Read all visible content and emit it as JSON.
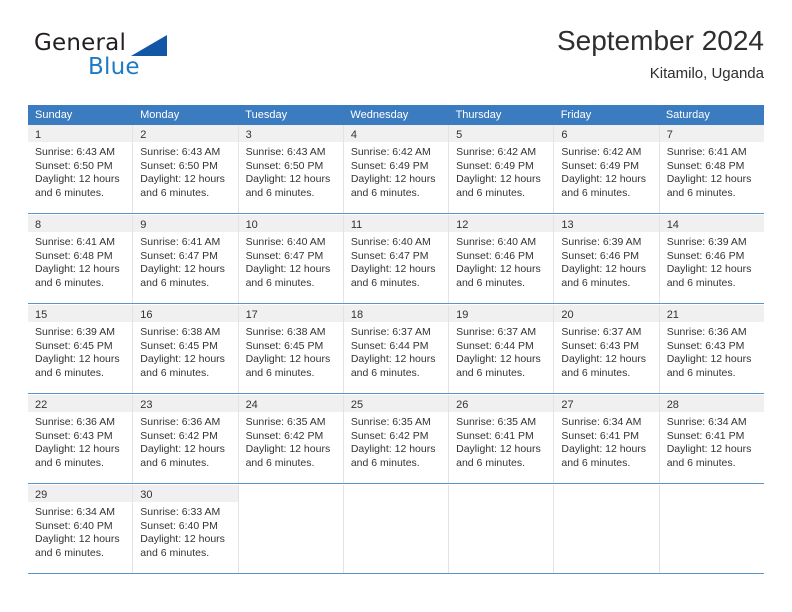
{
  "brand": {
    "name_part1": "General",
    "name_part2": "Blue",
    "logo_icon": "triangle-logo-icon"
  },
  "header": {
    "title": "September 2024",
    "subtitle": "Kitamilo, Uganda"
  },
  "calendar": {
    "weekday_headers": [
      "Sunday",
      "Monday",
      "Tuesday",
      "Wednesday",
      "Thursday",
      "Friday",
      "Saturday"
    ],
    "colors": {
      "header_blue": "#3b7cc0",
      "week_divider_blue": "#5b93cd",
      "day_band_gray": "#f0f0f0",
      "brand_blue": "#1f7ac4",
      "logo_triangle_blue": "#1257a5"
    },
    "weeks": [
      [
        {
          "day": "1",
          "sunrise": "Sunrise: 6:43 AM",
          "sunset": "Sunset: 6:50 PM",
          "daylight_line1": "Daylight: 12 hours",
          "daylight_line2": "and 6 minutes."
        },
        {
          "day": "2",
          "sunrise": "Sunrise: 6:43 AM",
          "sunset": "Sunset: 6:50 PM",
          "daylight_line1": "Daylight: 12 hours",
          "daylight_line2": "and 6 minutes."
        },
        {
          "day": "3",
          "sunrise": "Sunrise: 6:43 AM",
          "sunset": "Sunset: 6:50 PM",
          "daylight_line1": "Daylight: 12 hours",
          "daylight_line2": "and 6 minutes."
        },
        {
          "day": "4",
          "sunrise": "Sunrise: 6:42 AM",
          "sunset": "Sunset: 6:49 PM",
          "daylight_line1": "Daylight: 12 hours",
          "daylight_line2": "and 6 minutes."
        },
        {
          "day": "5",
          "sunrise": "Sunrise: 6:42 AM",
          "sunset": "Sunset: 6:49 PM",
          "daylight_line1": "Daylight: 12 hours",
          "daylight_line2": "and 6 minutes."
        },
        {
          "day": "6",
          "sunrise": "Sunrise: 6:42 AM",
          "sunset": "Sunset: 6:49 PM",
          "daylight_line1": "Daylight: 12 hours",
          "daylight_line2": "and 6 minutes."
        },
        {
          "day": "7",
          "sunrise": "Sunrise: 6:41 AM",
          "sunset": "Sunset: 6:48 PM",
          "daylight_line1": "Daylight: 12 hours",
          "daylight_line2": "and 6 minutes."
        }
      ],
      [
        {
          "day": "8",
          "sunrise": "Sunrise: 6:41 AM",
          "sunset": "Sunset: 6:48 PM",
          "daylight_line1": "Daylight: 12 hours",
          "daylight_line2": "and 6 minutes."
        },
        {
          "day": "9",
          "sunrise": "Sunrise: 6:41 AM",
          "sunset": "Sunset: 6:47 PM",
          "daylight_line1": "Daylight: 12 hours",
          "daylight_line2": "and 6 minutes."
        },
        {
          "day": "10",
          "sunrise": "Sunrise: 6:40 AM",
          "sunset": "Sunset: 6:47 PM",
          "daylight_line1": "Daylight: 12 hours",
          "daylight_line2": "and 6 minutes."
        },
        {
          "day": "11",
          "sunrise": "Sunrise: 6:40 AM",
          "sunset": "Sunset: 6:47 PM",
          "daylight_line1": "Daylight: 12 hours",
          "daylight_line2": "and 6 minutes."
        },
        {
          "day": "12",
          "sunrise": "Sunrise: 6:40 AM",
          "sunset": "Sunset: 6:46 PM",
          "daylight_line1": "Daylight: 12 hours",
          "daylight_line2": "and 6 minutes."
        },
        {
          "day": "13",
          "sunrise": "Sunrise: 6:39 AM",
          "sunset": "Sunset: 6:46 PM",
          "daylight_line1": "Daylight: 12 hours",
          "daylight_line2": "and 6 minutes."
        },
        {
          "day": "14",
          "sunrise": "Sunrise: 6:39 AM",
          "sunset": "Sunset: 6:46 PM",
          "daylight_line1": "Daylight: 12 hours",
          "daylight_line2": "and 6 minutes."
        }
      ],
      [
        {
          "day": "15",
          "sunrise": "Sunrise: 6:39 AM",
          "sunset": "Sunset: 6:45 PM",
          "daylight_line1": "Daylight: 12 hours",
          "daylight_line2": "and 6 minutes."
        },
        {
          "day": "16",
          "sunrise": "Sunrise: 6:38 AM",
          "sunset": "Sunset: 6:45 PM",
          "daylight_line1": "Daylight: 12 hours",
          "daylight_line2": "and 6 minutes."
        },
        {
          "day": "17",
          "sunrise": "Sunrise: 6:38 AM",
          "sunset": "Sunset: 6:45 PM",
          "daylight_line1": "Daylight: 12 hours",
          "daylight_line2": "and 6 minutes."
        },
        {
          "day": "18",
          "sunrise": "Sunrise: 6:37 AM",
          "sunset": "Sunset: 6:44 PM",
          "daylight_line1": "Daylight: 12 hours",
          "daylight_line2": "and 6 minutes."
        },
        {
          "day": "19",
          "sunrise": "Sunrise: 6:37 AM",
          "sunset": "Sunset: 6:44 PM",
          "daylight_line1": "Daylight: 12 hours",
          "daylight_line2": "and 6 minutes."
        },
        {
          "day": "20",
          "sunrise": "Sunrise: 6:37 AM",
          "sunset": "Sunset: 6:43 PM",
          "daylight_line1": "Daylight: 12 hours",
          "daylight_line2": "and 6 minutes."
        },
        {
          "day": "21",
          "sunrise": "Sunrise: 6:36 AM",
          "sunset": "Sunset: 6:43 PM",
          "daylight_line1": "Daylight: 12 hours",
          "daylight_line2": "and 6 minutes."
        }
      ],
      [
        {
          "day": "22",
          "sunrise": "Sunrise: 6:36 AM",
          "sunset": "Sunset: 6:43 PM",
          "daylight_line1": "Daylight: 12 hours",
          "daylight_line2": "and 6 minutes."
        },
        {
          "day": "23",
          "sunrise": "Sunrise: 6:36 AM",
          "sunset": "Sunset: 6:42 PM",
          "daylight_line1": "Daylight: 12 hours",
          "daylight_line2": "and 6 minutes."
        },
        {
          "day": "24",
          "sunrise": "Sunrise: 6:35 AM",
          "sunset": "Sunset: 6:42 PM",
          "daylight_line1": "Daylight: 12 hours",
          "daylight_line2": "and 6 minutes."
        },
        {
          "day": "25",
          "sunrise": "Sunrise: 6:35 AM",
          "sunset": "Sunset: 6:42 PM",
          "daylight_line1": "Daylight: 12 hours",
          "daylight_line2": "and 6 minutes."
        },
        {
          "day": "26",
          "sunrise": "Sunrise: 6:35 AM",
          "sunset": "Sunset: 6:41 PM",
          "daylight_line1": "Daylight: 12 hours",
          "daylight_line2": "and 6 minutes."
        },
        {
          "day": "27",
          "sunrise": "Sunrise: 6:34 AM",
          "sunset": "Sunset: 6:41 PM",
          "daylight_line1": "Daylight: 12 hours",
          "daylight_line2": "and 6 minutes."
        },
        {
          "day": "28",
          "sunrise": "Sunrise: 6:34 AM",
          "sunset": "Sunset: 6:41 PM",
          "daylight_line1": "Daylight: 12 hours",
          "daylight_line2": "and 6 minutes."
        }
      ],
      [
        {
          "day": "29",
          "sunrise": "Sunrise: 6:34 AM",
          "sunset": "Sunset: 6:40 PM",
          "daylight_line1": "Daylight: 12 hours",
          "daylight_line2": "and 6 minutes."
        },
        {
          "day": "30",
          "sunrise": "Sunrise: 6:33 AM",
          "sunset": "Sunset: 6:40 PM",
          "daylight_line1": "Daylight: 12 hours",
          "daylight_line2": "and 6 minutes."
        },
        {
          "day": "",
          "sunrise": "",
          "sunset": "",
          "daylight_line1": "",
          "daylight_line2": ""
        },
        {
          "day": "",
          "sunrise": "",
          "sunset": "",
          "daylight_line1": "",
          "daylight_line2": ""
        },
        {
          "day": "",
          "sunrise": "",
          "sunset": "",
          "daylight_line1": "",
          "daylight_line2": ""
        },
        {
          "day": "",
          "sunrise": "",
          "sunset": "",
          "daylight_line1": "",
          "daylight_line2": ""
        },
        {
          "day": "",
          "sunrise": "",
          "sunset": "",
          "daylight_line1": "",
          "daylight_line2": ""
        }
      ]
    ]
  }
}
